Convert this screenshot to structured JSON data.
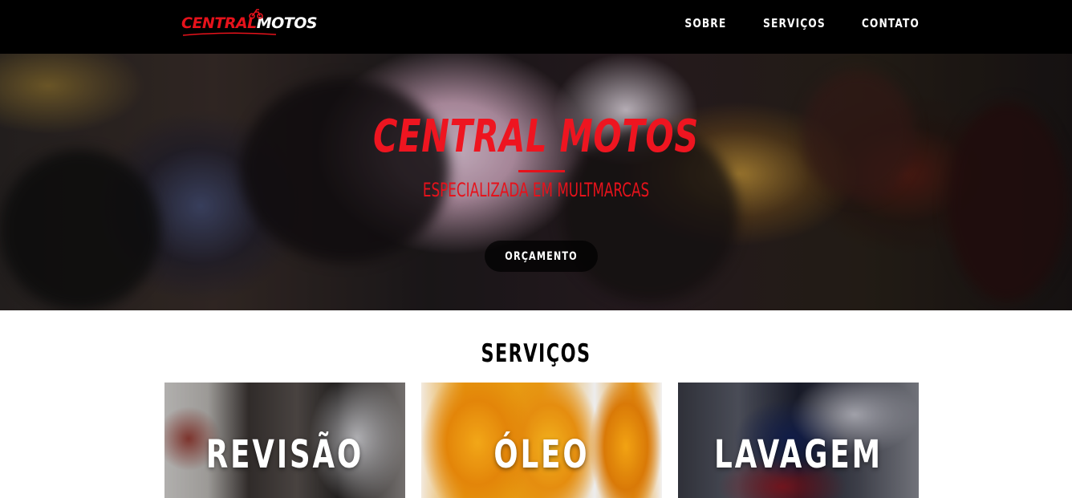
{
  "navbar": {
    "logo_text_red": "CENTRAL",
    "logo_text_white": "MOTOS",
    "links": [
      {
        "label": "SOBRE"
      },
      {
        "label": "SERVIÇOS"
      },
      {
        "label": "CONTATO"
      }
    ]
  },
  "hero": {
    "title": "CENTRAL MOTOS",
    "subtitle": "ESPECIALIZADA EM MULTMARCAS",
    "cta_label": "ORÇAMENTO"
  },
  "services": {
    "title": "SERVIÇOS",
    "cards": [
      {
        "label": "REVISÃO"
      },
      {
        "label": "ÓLEO"
      },
      {
        "label": "LAVAGEM"
      }
    ]
  },
  "colors": {
    "accent": "#e6121b",
    "navbar_bg": "#000000",
    "button_bg": "#1a1a1a"
  }
}
